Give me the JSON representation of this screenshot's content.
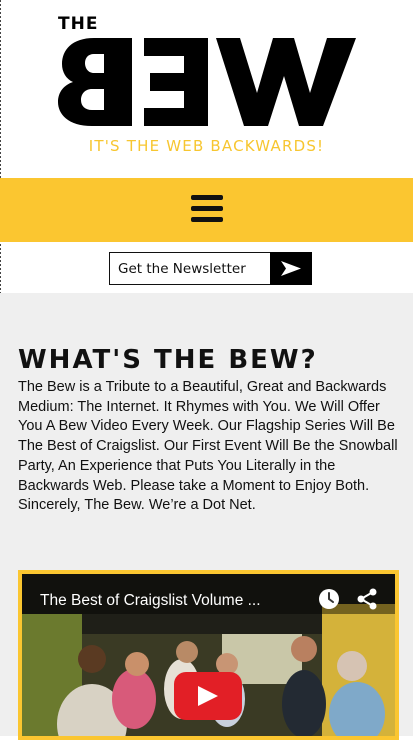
{
  "header": {
    "logo_the": "THE",
    "logo_word": "BEW",
    "tagline": "IT'S THE WEB BACKWARDS!"
  },
  "nav": {
    "menu_icon": "hamburger-menu-icon"
  },
  "newsletter": {
    "label": "Get the Newsletter",
    "submit_icon": "arrow-right-icon"
  },
  "main": {
    "heading": "WHAT'S THE BEW?",
    "body": "The Bew is a Tribute to a Beautiful, Great and Backwards Medium: The Internet.  It Rhymes with You.  We Will Offer You A Bew Video Every Week.  Our Flagship Series Will Be The Best of Craigslist.  Our First Event Will Be the Snowball Party, An Experience that Puts You Literally in the Backwards Web.  Please take a Moment to Enjoy Both.  Sincerely, The Bew.  We’re a Dot Net."
  },
  "video": {
    "title": "The Best of Craigslist Volume ...",
    "icons": [
      "watch-later-clock-icon",
      "share-icon",
      "play-icon"
    ]
  },
  "colors": {
    "accent": "#fbc630",
    "play": "#e21f26",
    "text": "#111111"
  }
}
